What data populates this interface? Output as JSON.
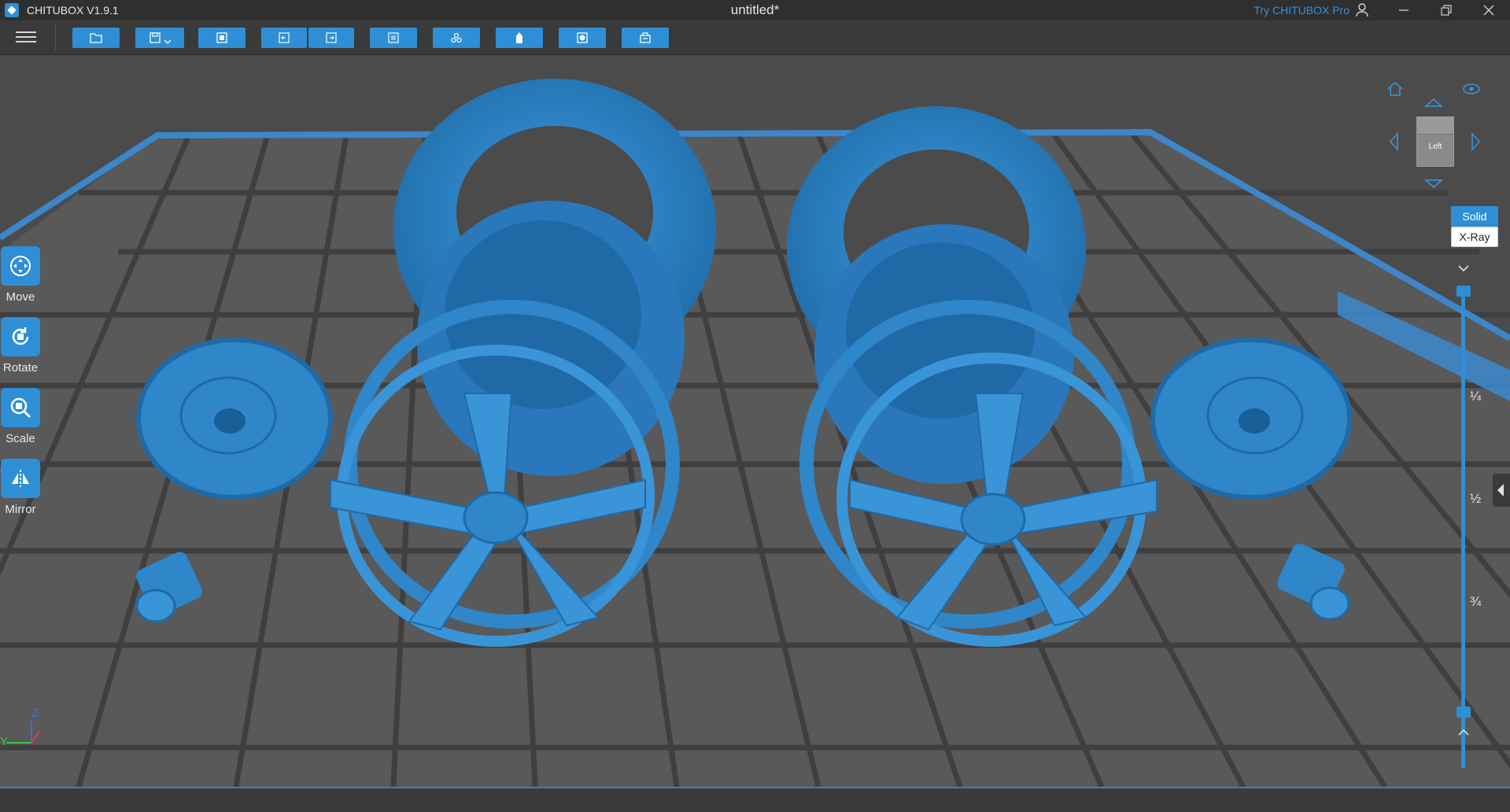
{
  "titlebar": {
    "app_name": "CHITUBOX V1.9.1",
    "document_title": "untitled*",
    "try_pro_label": "Try CHITUBOX Pro"
  },
  "toolbar": {
    "buttons": [
      "open-file-icon",
      "save-icon",
      "fit-view-icon",
      "undo-icon",
      "redo-icon",
      "slice-settings-icon",
      "arrange-icon",
      "supports-icon",
      "hollow-icon",
      "slice-export-icon"
    ]
  },
  "left_tools": [
    {
      "label": "Move",
      "icon": "move-icon"
    },
    {
      "label": "Rotate",
      "icon": "rotate-icon"
    },
    {
      "label": "Scale",
      "icon": "scale-icon"
    },
    {
      "label": "Mirror",
      "icon": "mirror-icon"
    }
  ],
  "view_cube": {
    "face_label": "Left"
  },
  "render_modes": {
    "solid": "Solid",
    "xray": "X-Ray",
    "active": "Solid"
  },
  "layer_slider": {
    "ticks": [
      "¼",
      "½",
      "¾"
    ],
    "upper_fraction": 1.0,
    "lower_fraction": 0.0
  },
  "axes": {
    "z": "Z",
    "y": "Y"
  },
  "colors": {
    "accent": "#2e8fd6",
    "model": "#2f86c9",
    "platform": "#595959",
    "grid": "#3e3e3e"
  }
}
